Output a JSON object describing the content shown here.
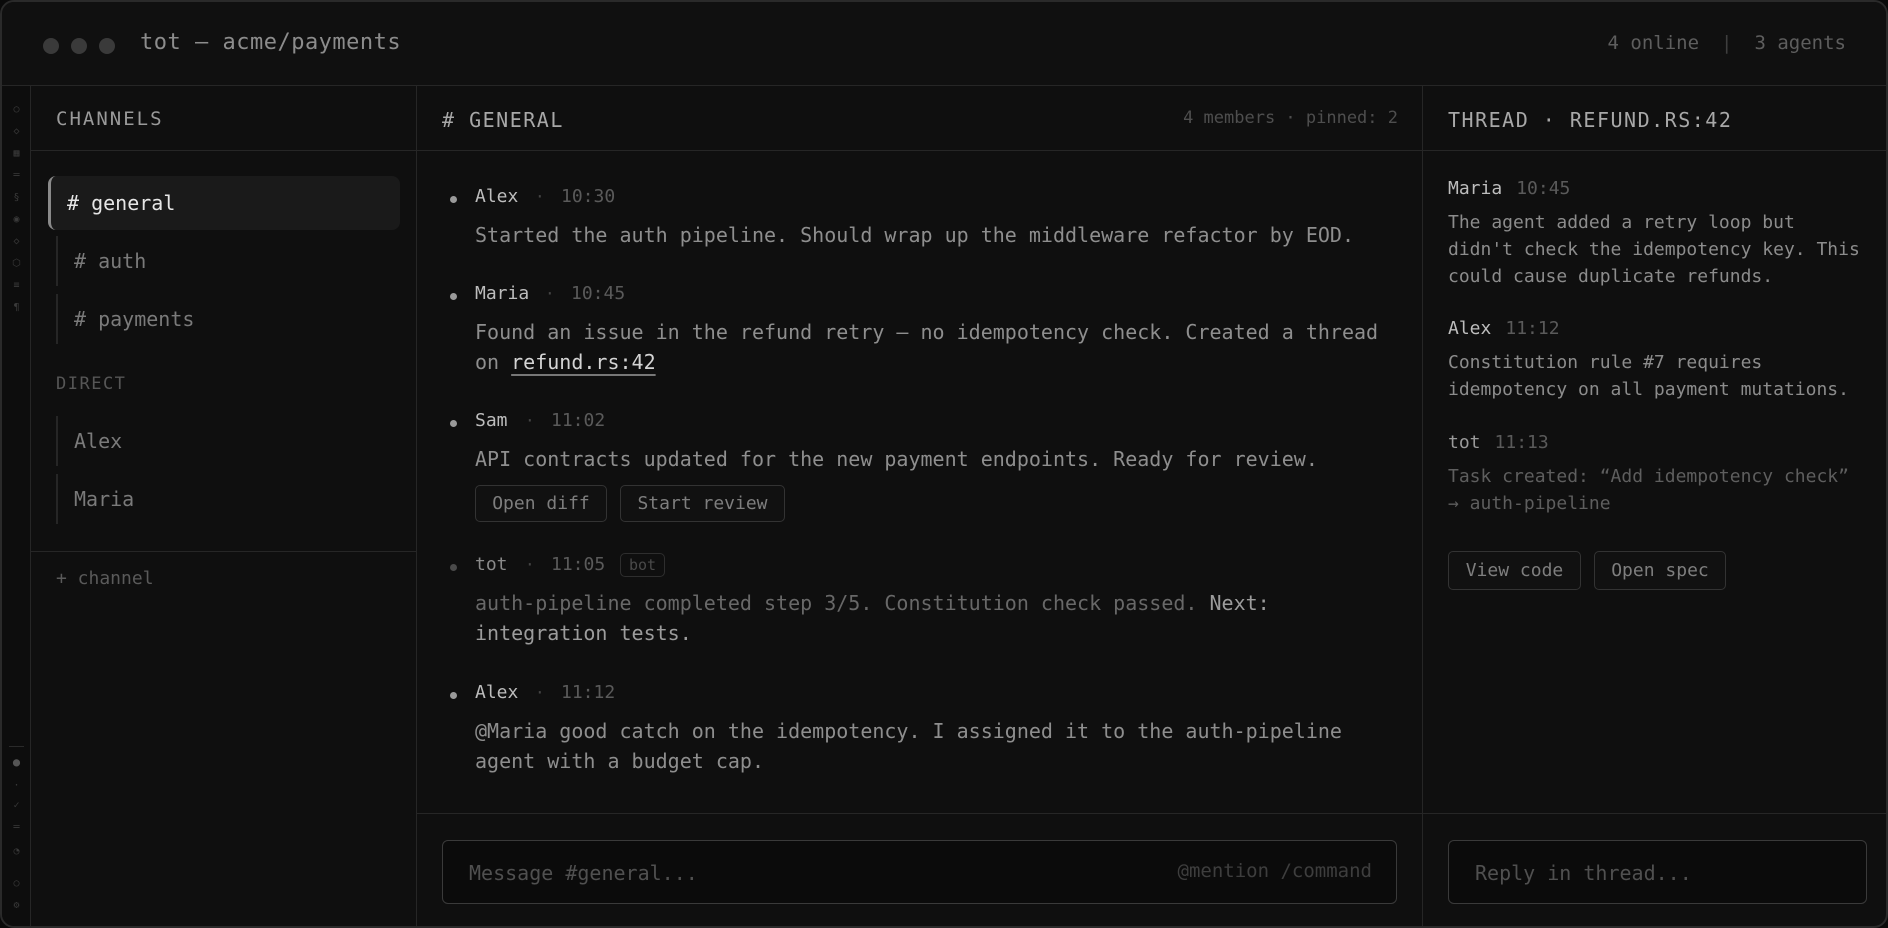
{
  "window": {
    "title": "tot — acme/payments",
    "online": "4 online",
    "separator": "|",
    "agents": "3 agents"
  },
  "strip": {
    "icons": [
      "circle-icon",
      "diamond-icon",
      "grid-icon",
      "minus-icon",
      "s-icon",
      "dot-icon",
      "diamond-icon",
      "hex-icon",
      "bars-icon",
      "pilcrow-icon"
    ],
    "bottom_icons": [
      "filled-dot-icon",
      "small-dot-icon",
      "check-icon",
      "lines-icon",
      "half-circle-icon",
      "ring-icon",
      "gear-icon"
    ]
  },
  "channels": {
    "header": "CHANNELS",
    "items": [
      {
        "label": "# general",
        "active": true
      },
      {
        "label": "# auth"
      },
      {
        "label": "# payments"
      }
    ],
    "direct_label": "DIRECT",
    "direct": [
      {
        "label": "Alex"
      },
      {
        "label": "Maria"
      }
    ],
    "add_channel": "+ channel"
  },
  "main": {
    "header": "# GENERAL",
    "meta": "4 members · pinned: 2",
    "separator": "·",
    "messages": [
      {
        "author": "Alex",
        "time": "10:30",
        "body": "Started the auth pipeline. Should wrap up the middleware refactor by EOD."
      },
      {
        "author": "Maria",
        "time": "10:45",
        "body": "Found an issue in the refund retry — no idempotency check. Created a thread",
        "body2": "on",
        "link": "refund.rs:42"
      },
      {
        "author": "Sam",
        "time": "11:02",
        "body": "API contracts updated for the new payment endpoints. Ready for review.",
        "buttons": [
          "Open diff",
          "Start review"
        ]
      },
      {
        "author": "tot",
        "time": "11:05",
        "badge": "bot",
        "body": "auth-pipeline completed step 3/5. Constitution check passed.",
        "body_hl": "Next:",
        "body2": "integration tests."
      },
      {
        "author": "Alex",
        "time": "11:12",
        "body": "@Maria good catch on the idempotency. I assigned it to the auth-pipeline",
        "body2": "agent with a budget cap."
      }
    ],
    "composer": {
      "placeholder": "Message #general...",
      "hints": "@mention /command"
    }
  },
  "thread": {
    "header": "THREAD · REFUND.RS:42",
    "messages": [
      {
        "author": "Maria",
        "time": "10:45",
        "lines": [
          "The agent added a retry loop but",
          "didn't check the idempotency key. This",
          "could cause duplicate refunds."
        ]
      },
      {
        "author": "Alex",
        "time": "11:12",
        "lines": [
          "Constitution rule #7 requires",
          "idempotency on all payment mutations."
        ]
      },
      {
        "author": "tot",
        "time": "11:13",
        "lines": [
          "Task created: “Add idempotency check”",
          "→ auth-pipeline"
        ]
      }
    ],
    "buttons": [
      "View code",
      "Open spec"
    ],
    "composer": {
      "placeholder": "Reply in thread..."
    }
  }
}
